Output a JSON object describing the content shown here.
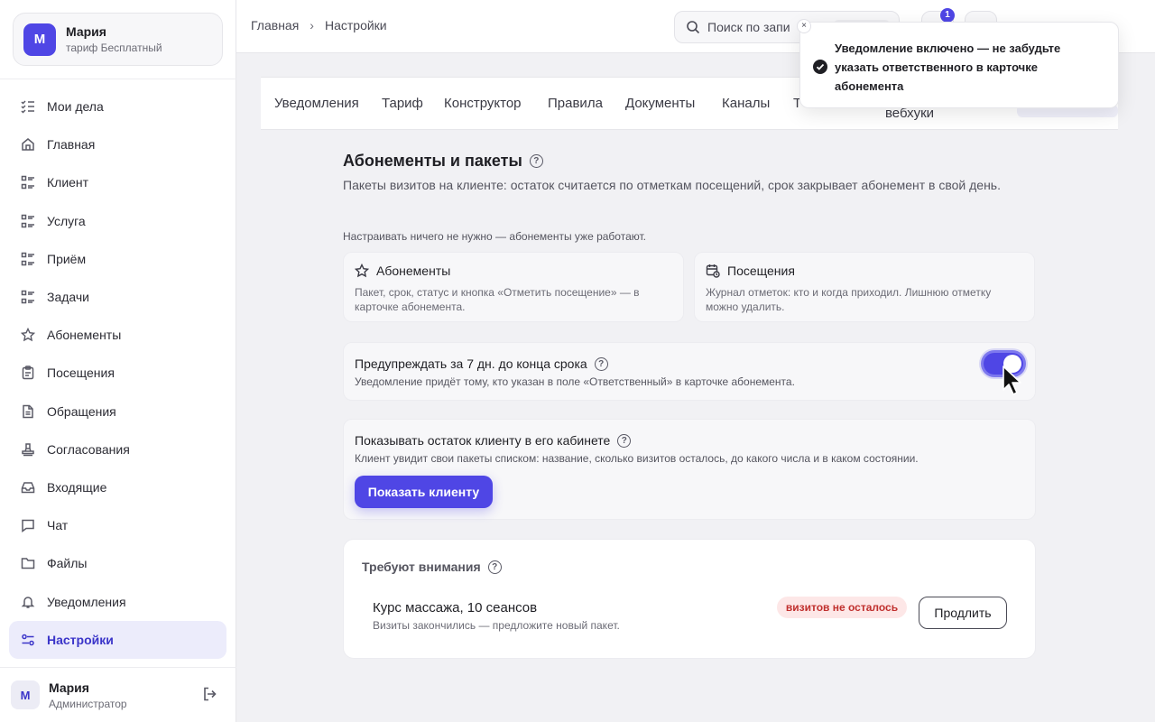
{
  "account": {
    "initial": "М",
    "name": "Мария",
    "plan": "тариф Бесплатный"
  },
  "sidebar": {
    "items": [
      {
        "label": "Мои дела",
        "icon": "checklist-icon"
      },
      {
        "label": "Главная",
        "icon": "home-icon"
      },
      {
        "label": "Клиент",
        "icon": "list-icon"
      },
      {
        "label": "Услуга",
        "icon": "list-icon"
      },
      {
        "label": "Приём",
        "icon": "list-icon"
      },
      {
        "label": "Задачи",
        "icon": "list-icon"
      },
      {
        "label": "Абонементы",
        "icon": "star-icon"
      },
      {
        "label": "Посещения",
        "icon": "clipboard-icon"
      },
      {
        "label": "Обращения",
        "icon": "document-icon"
      },
      {
        "label": "Согласования",
        "icon": "stamp-icon"
      },
      {
        "label": "Входящие",
        "icon": "inbox-icon"
      },
      {
        "label": "Чат",
        "icon": "chat-icon"
      },
      {
        "label": "Файлы",
        "icon": "folder-icon"
      },
      {
        "label": "Уведомления",
        "icon": "bell-icon"
      },
      {
        "label": "Настройки",
        "icon": "sliders-icon"
      }
    ],
    "active": "Настройки"
  },
  "user": {
    "initial": "М",
    "name": "Мария",
    "role": "Администратор"
  },
  "breadcrumb": {
    "home": "Главная",
    "current": "Настройки"
  },
  "search": {
    "placeholder": "Поиск по запи"
  },
  "notifications_count": "1",
  "tabs": [
    "Уведомления",
    "Тариф",
    "Конструктор",
    "Правила",
    "Документы",
    "Каналы",
    "Т"
  ],
  "tab_extra": "вебхуки",
  "toast": {
    "message": "Уведомление включено — не забудьте указать ответственного в карточке абонемента",
    "close": "×"
  },
  "section": {
    "title": "Абонементы и пакеты",
    "description": "Пакеты визитов на клиенте: остаток считается по отметкам посещений, срок закрывает абонемент в свой день.",
    "note": "Настраивать ничего не нужно — абонементы уже работают."
  },
  "cards": [
    {
      "title": "Абонементы",
      "desc": "Пакет, срок, статус и кнопка «Отметить посещение» — в карточке абонемента."
    },
    {
      "title": "Посещения",
      "desc": "Журнал отметок: кто и когда приходил. Лишнюю отметку можно удалить."
    }
  ],
  "reminder": {
    "title": "Предупреждать за 7 дн. до конца срока",
    "desc": "Уведомление придёт тому, кто указан в поле «Ответственный» в карточке абонемента.",
    "enabled": true
  },
  "client_view": {
    "title": "Показывать остаток клиенту в его кабинете",
    "desc": "Клиент увидит свои пакеты списком: название, сколько визитов осталось, до какого числа и в каком состоянии.",
    "button": "Показать клиенту"
  },
  "attention": {
    "title": "Требуют внимания",
    "item": {
      "title": "Курс массажа, 10 сеансов",
      "desc": "Визиты закончились — предложите новый пакет.",
      "badge": "визитов не осталось",
      "action": "Продлить"
    }
  },
  "colors": {
    "accent": "#4f46e5",
    "danger": "#c0302e"
  }
}
